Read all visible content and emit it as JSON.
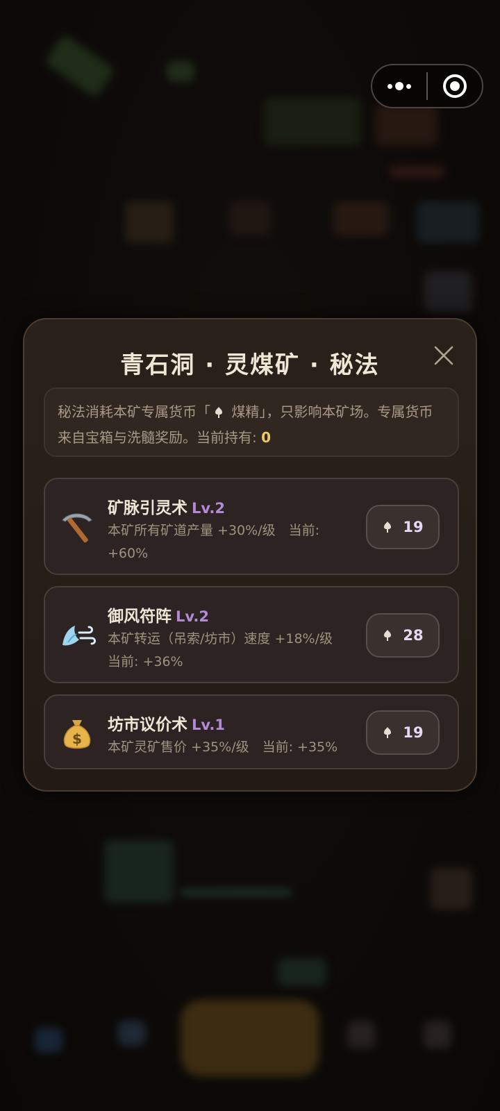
{
  "capsule": {
    "more_icon": "more-dots-icon",
    "close_icon": "target-close-icon"
  },
  "modal": {
    "title": "青石洞 · 灵煤矿 · 秘法",
    "close_icon": "close-x-icon",
    "info": {
      "text_before": "秘法消耗本矿专属货币「",
      "currency_icon": "leaf-gem-icon",
      "currency_name": " 煤精",
      "text_after": "」，只影响本矿场。专属货币来自宝箱与洗髓奖励。当前持有:",
      "holding": "0"
    },
    "skills": [
      {
        "icon": "pickaxe-icon",
        "name": "矿脉引灵术",
        "level": "Lv.2",
        "desc": "本矿所有矿道产量 +30%/级　当前: +60%",
        "cost": "19",
        "cost_icon": "leaf-gem-icon"
      },
      {
        "icon": "wind-icon",
        "name": "御风符阵",
        "level": "Lv.2",
        "desc": "本矿转运（吊索/坊市）速度 +18%/级 当前: +36%",
        "cost": "28",
        "cost_icon": "leaf-gem-icon"
      },
      {
        "icon": "money-bag-icon",
        "name": "坊市议价术",
        "level": "Lv.1",
        "desc": "本矿灵矿售价 +35%/级　当前: +35%",
        "cost": "19",
        "cost_icon": "leaf-gem-icon"
      }
    ]
  },
  "colors": {
    "accent_level": "#b38ad6",
    "holding": "#f0c860",
    "modal_bg": "#241c16"
  }
}
